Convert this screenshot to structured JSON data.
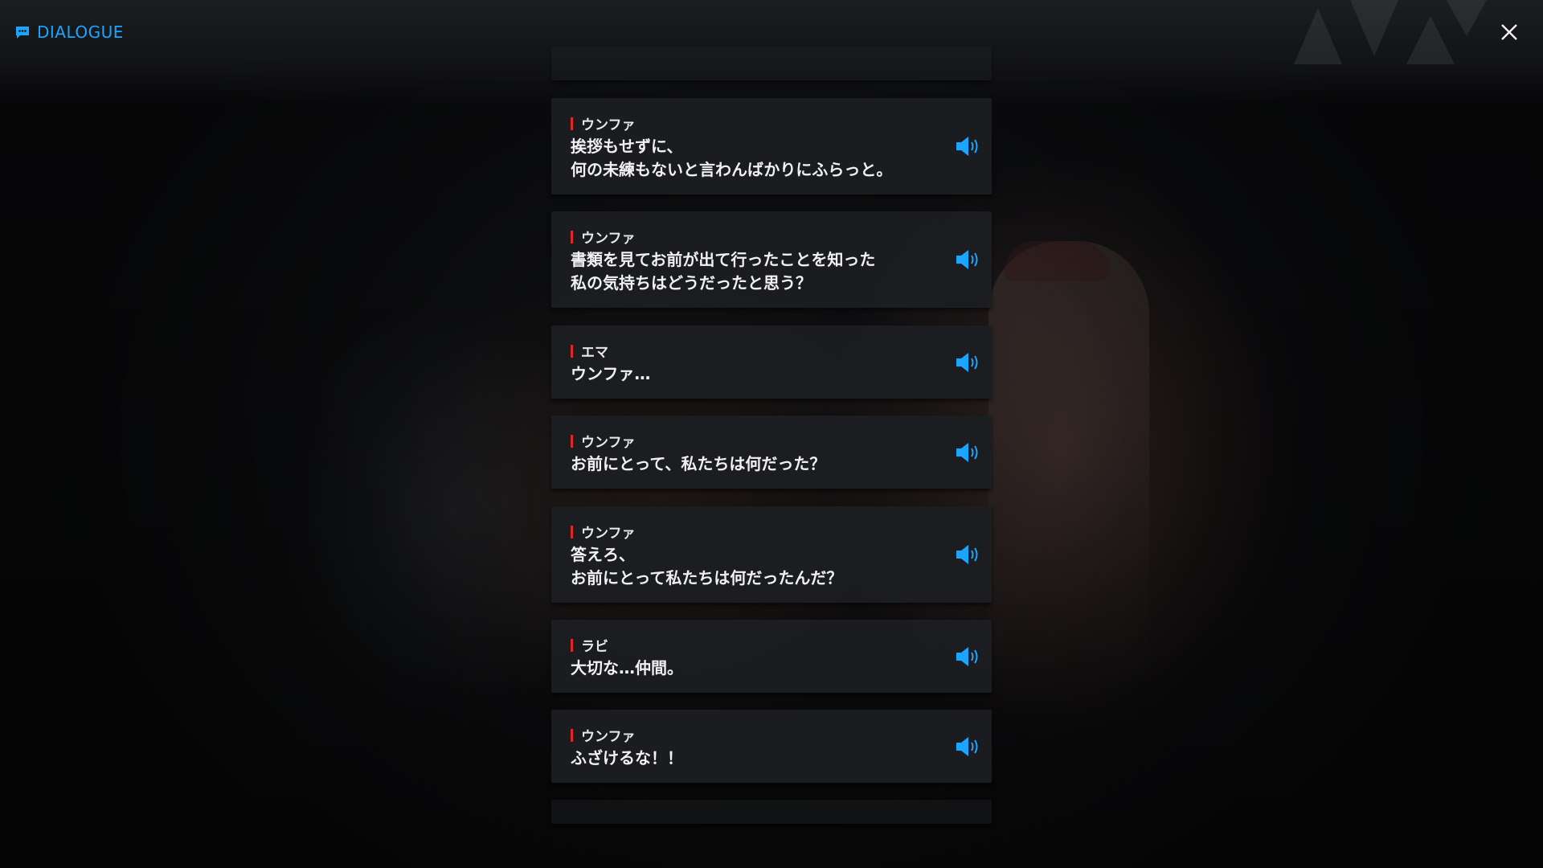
{
  "header": {
    "title": "DIALOGUE",
    "icon": "chat-bubble-icon",
    "accent_color": "#1aa6ff",
    "close_icon": "close-icon"
  },
  "dialogue": [
    {
      "speaker": "ウンファ",
      "lines": [
        "挨拶もせずに、",
        "何の未練もないと言わんばかりにふらっと。"
      ]
    },
    {
      "speaker": "ウンファ",
      "lines": [
        "書類を見てお前が出て行ったことを知った",
        "私の気持ちはどうだったと思う？"
      ]
    },
    {
      "speaker": "エマ",
      "lines": [
        "ウンファ…"
      ]
    },
    {
      "speaker": "ウンファ",
      "lines": [
        "お前にとって、私たちは何だった？"
      ]
    },
    {
      "speaker": "ウンファ",
      "lines": [
        "答えろ、",
        "お前にとって私たちは何だったんだ？"
      ]
    },
    {
      "speaker": "ラビ",
      "lines": [
        "大切な…仲間。"
      ]
    },
    {
      "speaker": "ウンファ",
      "lines": [
        "ふざけるな！！"
      ]
    }
  ],
  "colors": {
    "speaker_marker": "#e0252b",
    "voice_icon": "#1aa6ff"
  }
}
